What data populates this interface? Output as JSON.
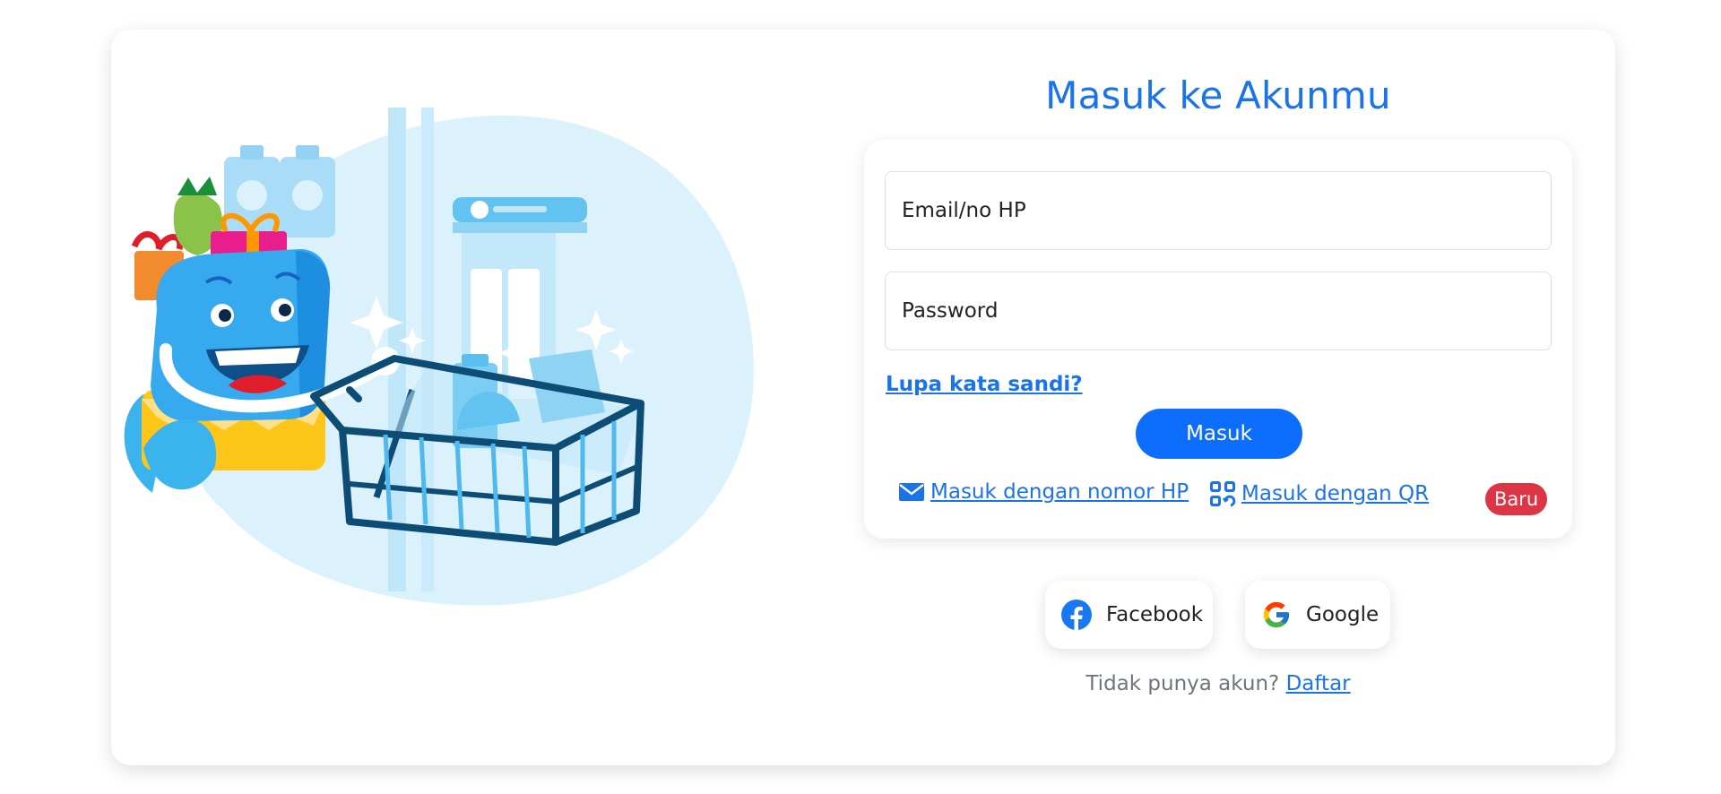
{
  "login": {
    "title": "Masuk ke Akunmu",
    "email_placeholder": "Email/no HP",
    "password_placeholder": "Password",
    "forgot_label": "Lupa kata sandi?",
    "submit_label": "Masuk",
    "phone_login_label": " Masuk dengan nomor HP",
    "qr_login_label": " Masuk dengan QR",
    "new_badge": "Baru"
  },
  "social": {
    "facebook_label": "Facebook",
    "google_label": "Google"
  },
  "signup": {
    "prompt": "Tidak punya akun? ",
    "link_label": "Daftar"
  },
  "icons": {
    "phone_login": "envelope-icon",
    "qr_login": "qr-icon",
    "facebook": "facebook-icon",
    "google": "google-icon"
  },
  "colors": {
    "accent": "#1a73e8",
    "primary_button": "#0d6efd",
    "badge": "#dc3545",
    "muted_text": "#6c757d"
  }
}
